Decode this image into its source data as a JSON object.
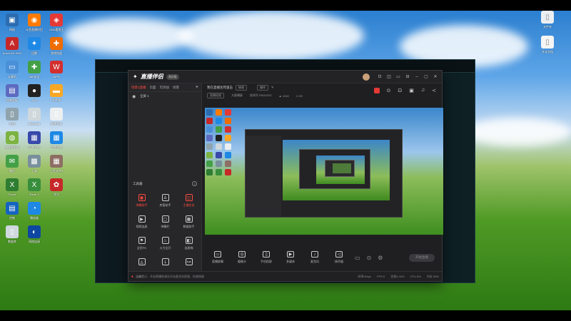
{
  "desktop": {
    "icons": [
      {
        "label": "网络",
        "icon": "network-icon",
        "color": "#2b6cb0",
        "glyph": "▣"
      },
      {
        "label": "斗鱼直播伴侣",
        "icon": "douyu-icon",
        "color": "#ff7a00",
        "glyph": "◉"
      },
      {
        "label": "2345看图王",
        "icon": "picture-viewer-icon",
        "color": "#e53935",
        "glyph": "◈"
      },
      {
        "label": "AutoCAD 2014",
        "icon": "autocad-icon",
        "color": "#c62828",
        "glyph": "A"
      },
      {
        "label": "迅雷",
        "icon": "xunlei-icon",
        "color": "#1e88e5",
        "glyph": "✦"
      },
      {
        "label": "游戏加速",
        "icon": "game-icon",
        "color": "#ef6c00",
        "glyph": "✚"
      },
      {
        "label": "计算机",
        "icon": "computer-icon",
        "color": "#4a90d9",
        "glyph": "▭"
      },
      {
        "label": "360安全",
        "icon": "360-icon",
        "color": "#43a047",
        "glyph": "✚"
      },
      {
        "label": "WPS",
        "icon": "wps-icon",
        "color": "#d32f2f",
        "glyph": "W"
      },
      {
        "label": "控制面板",
        "icon": "control-panel-icon",
        "color": "#5c6bc0",
        "glyph": "▤"
      },
      {
        "label": "QQ",
        "icon": "qq-icon",
        "color": "#222",
        "glyph": "●"
      },
      {
        "label": "文件夹",
        "icon": "folder-icon",
        "color": "#f9a825",
        "glyph": "▬"
      },
      {
        "label": "文档",
        "icon": "document-icon",
        "color": "#90a4ae",
        "glyph": "▯"
      },
      {
        "label": "Microsoft",
        "icon": "document-icon",
        "color": "#cfd8dc",
        "glyph": "▯"
      },
      {
        "label": "新建文本",
        "icon": "document-icon",
        "color": "#eceff1",
        "glyph": "▯"
      },
      {
        "label": "360浏览器",
        "icon": "browser-icon",
        "color": "#7cb342",
        "glyph": "◍"
      },
      {
        "label": "压缩文件",
        "icon": "archive-icon",
        "color": "#3949ab",
        "glyph": "▦"
      },
      {
        "label": "工程文件",
        "icon": "archive-icon",
        "color": "#1e88e5",
        "glyph": "▦"
      },
      {
        "label": "微信",
        "icon": "wechat-icon",
        "color": "#43a047",
        "glyph": "✉"
      },
      {
        "label": "工具",
        "icon": "tool-icon",
        "color": "#78909c",
        "glyph": "▩"
      },
      {
        "label": "工程文件2",
        "icon": "archive-icon",
        "color": "#8d6e63",
        "glyph": "▦"
      },
      {
        "label": "Excel",
        "icon": "excel-icon",
        "color": "#2e7d32",
        "glyph": "X"
      },
      {
        "label": "Excel 2",
        "icon": "excel-icon",
        "color": "#388e3c",
        "glyph": "X"
      },
      {
        "label": "华为",
        "icon": "huawei-icon",
        "color": "#c62828",
        "glyph": "✿"
      },
      {
        "label": "控制",
        "icon": "control-panel-icon",
        "color": "#1565c0",
        "glyph": "▤"
      },
      {
        "label": "播放器",
        "icon": "player-icon",
        "color": "#1e88e5",
        "glyph": "◔"
      },
      {
        "label": "",
        "icon": "",
        "color": "",
        "glyph": ""
      },
      {
        "label": "数据库",
        "icon": "database-icon",
        "color": "#cfd8dc",
        "glyph": "▯"
      },
      {
        "label": "网络连接",
        "icon": "network-icon",
        "color": "#0d47a1",
        "glyph": "◐"
      }
    ],
    "right_icons": [
      {
        "label": "文件夹",
        "icon": "folder-icon",
        "color": "#eceff1",
        "glyph": "▯"
      },
      {
        "label": "文本文档",
        "icon": "document-icon",
        "color": "#f5f5f5",
        "glyph": "▯"
      }
    ]
  },
  "app": {
    "title": "直播伴侣",
    "version": "测试版",
    "window_controls": [
      "⊡",
      "◫",
      "▭",
      "⊟",
      "–",
      "▢",
      "✕"
    ],
    "scene_tabs": [
      {
        "label": "场景1直播",
        "active": true
      },
      {
        "label": "页面",
        "active": false
      },
      {
        "label": "可添加",
        "active": false
      },
      {
        "label": "场景",
        "active": false
      }
    ],
    "scene_rows": [
      {
        "eye": "◉",
        "label": "全屏 1"
      }
    ],
    "tools_title": "工具箱",
    "tools": [
      {
        "label": "弹幕助手",
        "glyph": "▣",
        "red": true
      },
      {
        "label": "房管助手",
        "glyph": "♙",
        "red": false
      },
      {
        "label": "主播任务",
        "glyph": "◫",
        "red": true
      },
      {
        "label": "视频连麦",
        "glyph": "▶",
        "red": false
      },
      {
        "label": "弹幕栏",
        "glyph": "▢",
        "red": false
      },
      {
        "label": "数据助手",
        "glyph": "▦",
        "red": false
      },
      {
        "label": "全民PK",
        "glyph": "⚑",
        "red": false
      },
      {
        "label": "火力全开",
        "glyph": "♨",
        "red": false
      },
      {
        "label": "连麦嗨",
        "glyph": "◧",
        "red": false
      },
      {
        "label": "",
        "glyph": "◬",
        "red": false
      },
      {
        "label": "",
        "glyph": "⇣",
        "red": false
      },
      {
        "label": "",
        "glyph": "⊶",
        "red": false
      }
    ],
    "status_text": "温馨提示：开启直播前请先开启麦克风权限，检查网络",
    "status_stats": [
      "码率0kbps",
      "FPS:0",
      "丢帧0.00%",
      "CPU 8%",
      "内存 58%"
    ],
    "room": {
      "title": "我在直播生死狙击",
      "tag": "修改",
      "category": "操作",
      "meta_label": "直播权限",
      "meta_chip": "大屏横屏",
      "room_id": "房间号 93011022",
      "heat": "▲ 1318",
      "fans": "♙ 69"
    },
    "room_icons": [
      "⊙",
      "⊡",
      "▣",
      "♫",
      "≺"
    ],
    "controls": [
      {
        "label": "直播屏幕",
        "glyph": "▭"
      },
      {
        "label": "摄像头",
        "glyph": "◎"
      },
      {
        "label": "手机投屏",
        "glyph": "▯"
      },
      {
        "label": "多媒体",
        "glyph": "▶"
      },
      {
        "label": "麦克风",
        "glyph": "♪"
      },
      {
        "label": "扬声器",
        "glyph": "◁"
      }
    ],
    "controls_small": [
      "▭",
      "⊙",
      "⚙"
    ],
    "go_live": "开始直播"
  }
}
